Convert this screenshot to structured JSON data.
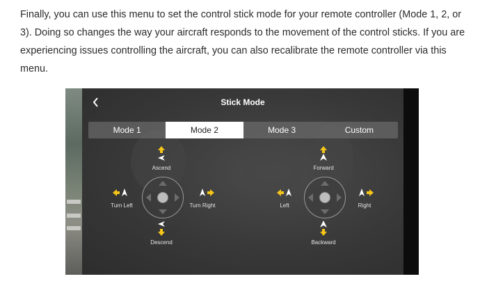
{
  "article": {
    "paragraph": "Finally, you can use this menu to set the control stick mode for your remote controller (Mode 1, 2, or 3). Doing so changes the way your aircraft responds to the movement of the control sticks. If you are experiencing issues controlling the aircraft, you can also recalibrate the remote controller via this menu."
  },
  "app": {
    "back_icon": "chevron-left-icon",
    "title": "Stick Mode",
    "tabs": [
      {
        "label": "Mode 1",
        "selected": false
      },
      {
        "label": "Mode 2",
        "selected": true
      },
      {
        "label": "Mode 3",
        "selected": false
      },
      {
        "label": "Custom",
        "selected": false
      }
    ],
    "left_stick": {
      "up_label": "Ascend",
      "down_label": "Descend",
      "left_label": "Turn Left",
      "right_label": "Turn Right"
    },
    "right_stick": {
      "up_label": "Forward",
      "down_label": "Backward",
      "left_label": "Left",
      "right_label": "Right"
    }
  },
  "colors": {
    "arrow": "#f5c518",
    "text": "#2b2b2b",
    "tab_active_bg": "#ffffff"
  }
}
